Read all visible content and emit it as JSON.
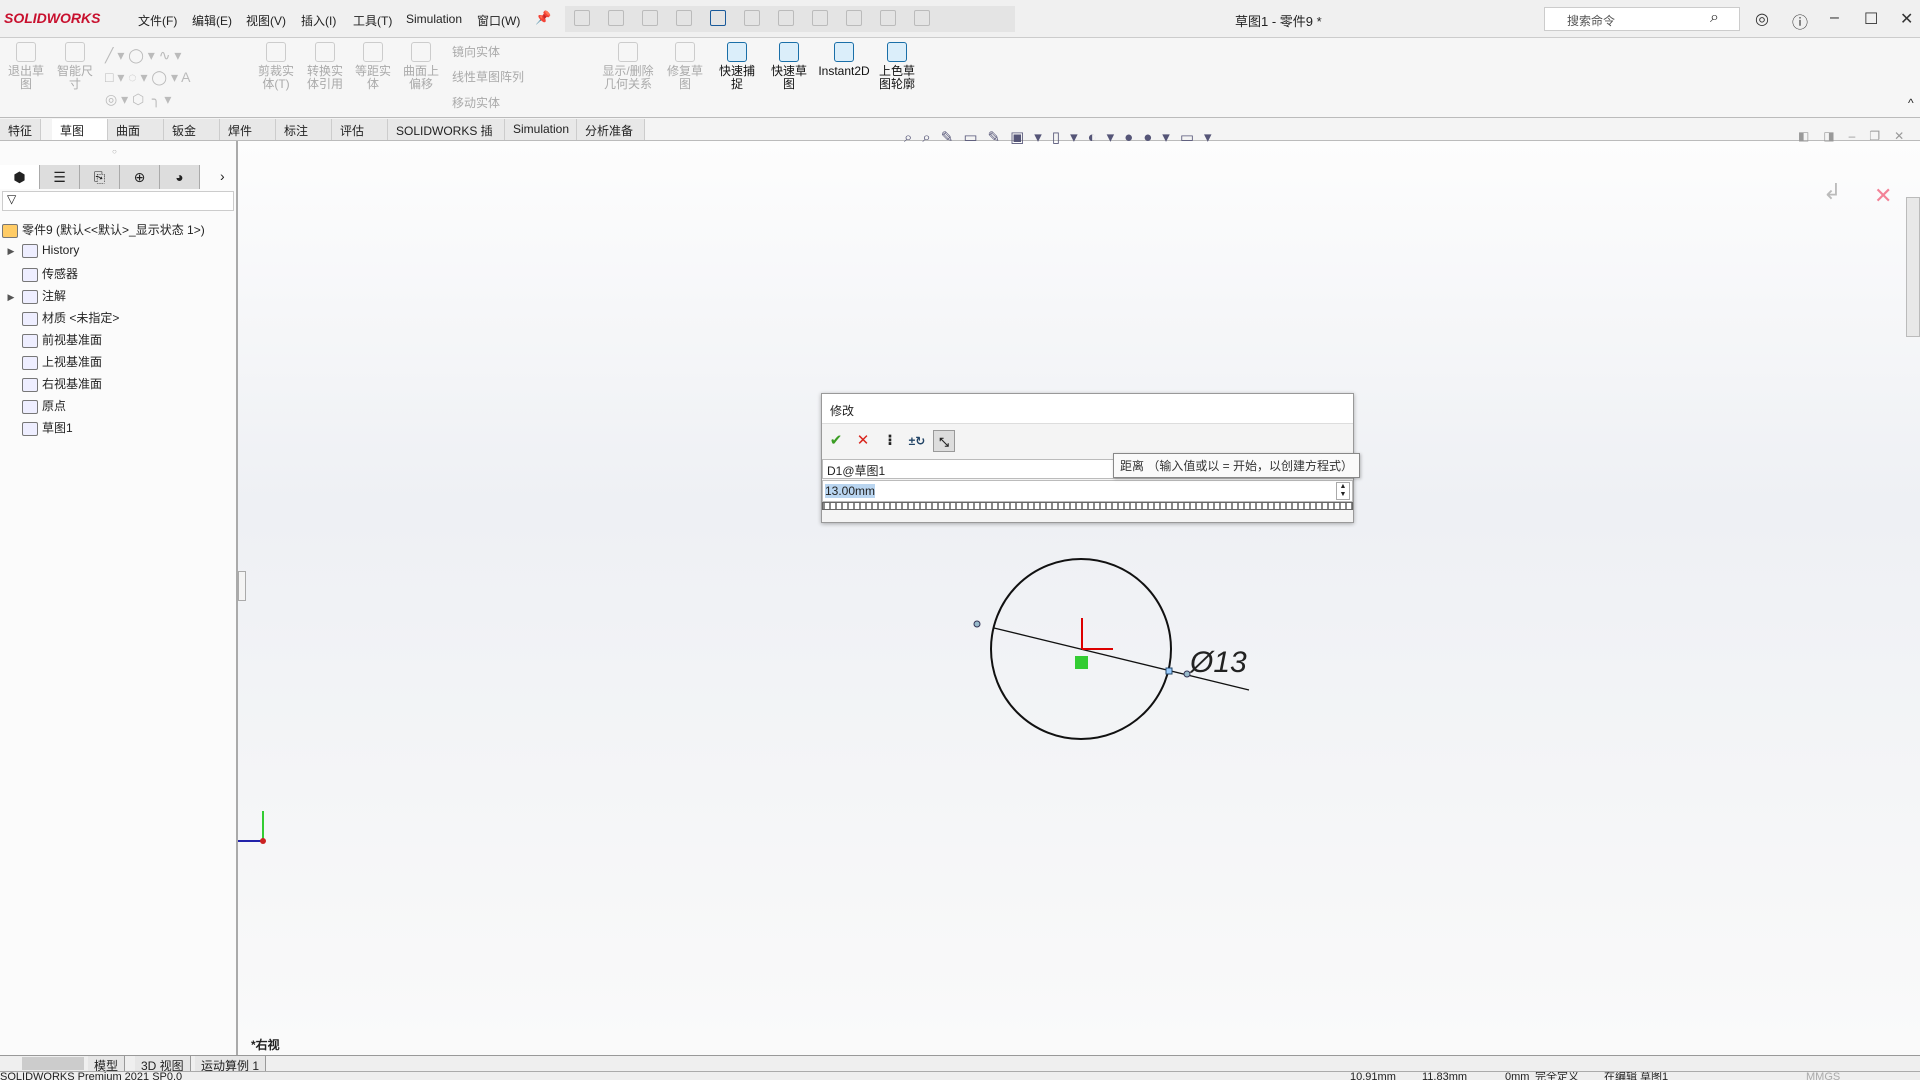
{
  "app": {
    "logo": "SOLIDWORKS",
    "title": "草图1 - 零件9 *",
    "search_placeholder": "搜索命令"
  },
  "menu": [
    "文件(F)",
    "编辑(E)",
    "视图(V)",
    "插入(I)",
    "工具(T)",
    "Simulation",
    "窗口(W)"
  ],
  "ribbon": {
    "buttons": [
      {
        "label": "退出草图",
        "enabled": false
      },
      {
        "label": "智能尺寸",
        "enabled": false
      },
      {
        "label": "剪裁实体(T)",
        "enabled": false
      },
      {
        "label": "转换实体引用",
        "enabled": false
      },
      {
        "label": "等距实体",
        "enabled": false
      },
      {
        "label": "曲面上偏移",
        "enabled": false
      },
      {
        "label": "显示/删除几何关系",
        "enabled": false
      },
      {
        "label": "修复草图",
        "enabled": false
      },
      {
        "label": "快速捕捉",
        "enabled": true
      },
      {
        "label": "快速草图",
        "enabled": true
      },
      {
        "label": "Instant2D",
        "enabled": true
      },
      {
        "label": "上色草图轮廓",
        "enabled": true
      }
    ],
    "small": [
      "镜向实体",
      "线性草图阵列",
      "移动实体"
    ]
  },
  "tabs": [
    {
      "label": "特征"
    },
    {
      "label": "草图",
      "active": true
    },
    {
      "label": "曲面"
    },
    {
      "label": "钣金"
    },
    {
      "label": "焊件"
    },
    {
      "label": "标注"
    },
    {
      "label": "评估"
    },
    {
      "label": "SOLIDWORKS 插件"
    },
    {
      "label": "Simulation"
    },
    {
      "label": "分析准备"
    }
  ],
  "feature_manager": {
    "root": "零件9  (默认<<默认>_显示状态 1>)",
    "items": [
      {
        "label": "History",
        "expandable": true,
        "icon": "history-folder-icon"
      },
      {
        "label": "传感器",
        "icon": "sensor-folder-icon"
      },
      {
        "label": "注解",
        "expandable": true,
        "icon": "annotation-folder-icon"
      },
      {
        "label": "材质 <未指定>",
        "icon": "material-icon"
      },
      {
        "label": "前视基准面",
        "icon": "plane-icon"
      },
      {
        "label": "上视基准面",
        "icon": "plane-icon"
      },
      {
        "label": "右视基准面",
        "icon": "plane-icon"
      },
      {
        "label": "原点",
        "icon": "origin-icon"
      },
      {
        "label": "草图1",
        "icon": "sketch-icon"
      }
    ]
  },
  "modify_dialog": {
    "title": "修改",
    "dimension_name": "D1@草图1",
    "value": "13.00mm",
    "tooltip": "距离  （输入值或以 = 开始，以创建方程式）"
  },
  "sketch": {
    "dimension_label": "Ø13",
    "view_name": "*右视"
  },
  "bottom_tabs": [
    "模型",
    "3D 视图",
    "运动算例 1"
  ],
  "status": {
    "product": "SOLIDWORKS Premium 2021 SP0.0",
    "x": "10.91mm",
    "y": "11.83mm",
    "z": "0mm",
    "state": "完全定义",
    "editing": "在编辑 草图1",
    "units": "MMGS"
  },
  "colors": {
    "accent": "#c8102e",
    "selection": "#b9d5f0",
    "ok": "#3a9d23",
    "cancel": "#d9251d"
  }
}
